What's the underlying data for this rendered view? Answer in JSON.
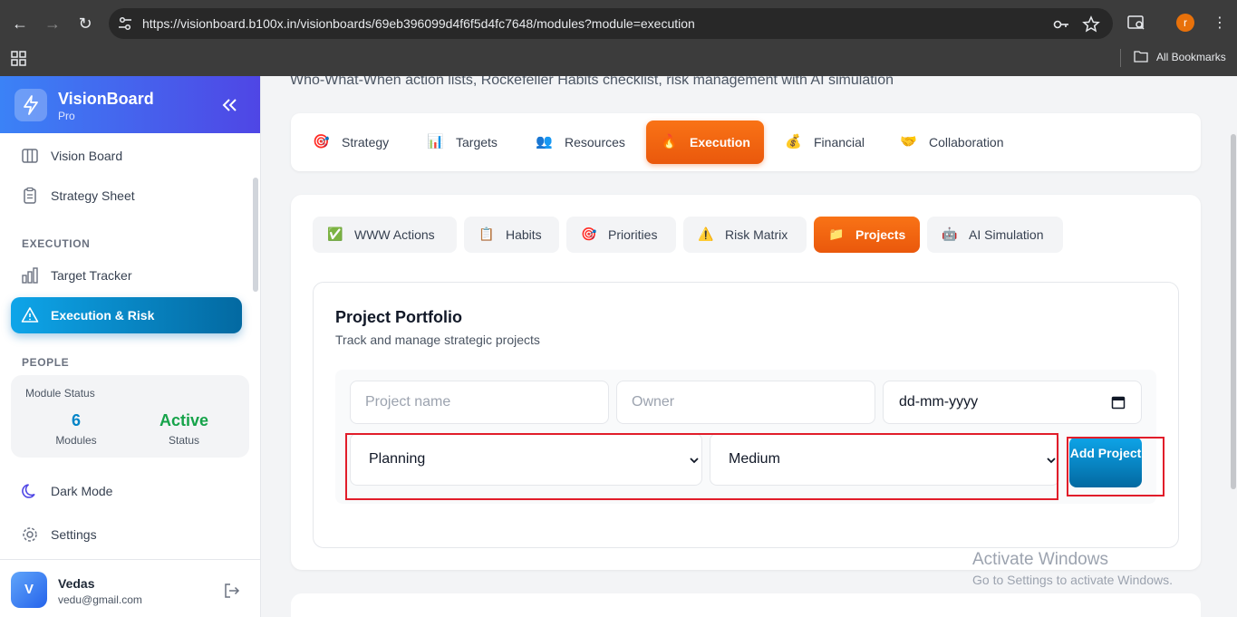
{
  "browser": {
    "url": "https://visionboard.b100x.in/visionboards/69eb396099d4f6f5d4fc7648/modules?module=execution",
    "profile_initial": "r",
    "bookmarks_label": "All Bookmarks"
  },
  "sidebar": {
    "brand_name": "VisionBoard",
    "brand_tier": "Pro",
    "items_top": [
      {
        "label": "Vision Board",
        "icon": "columns-icon"
      },
      {
        "label": "Strategy Sheet",
        "icon": "clipboard-icon"
      }
    ],
    "section_execution": "EXECUTION",
    "items_execution": [
      {
        "label": "Target Tracker",
        "icon": "bar-chart-icon"
      },
      {
        "label": "Execution & Risk",
        "icon": "warning-icon",
        "active": true
      }
    ],
    "section_people": "PEOPLE",
    "module_status": {
      "title": "Module Status",
      "modules_value": "6",
      "modules_label": "Modules",
      "status_value": "Active",
      "status_label": "Status"
    },
    "dark_mode": "Dark Mode",
    "settings": "Settings",
    "user": {
      "initial": "V",
      "name": "Vedas",
      "email": "vedu@gmail.com"
    }
  },
  "main": {
    "subtitle": "Who-What-When action lists, Rockefeller Habits checklist, risk management with AI simulation",
    "module_tabs": [
      {
        "label": "Strategy",
        "emoji": "🎯"
      },
      {
        "label": "Targets",
        "emoji": "📊"
      },
      {
        "label": "Resources",
        "emoji": "👥"
      },
      {
        "label": "Execution",
        "emoji": "🔥",
        "active": true
      },
      {
        "label": "Financial",
        "emoji": "💰"
      },
      {
        "label": "Collaboration",
        "emoji": "🤝"
      }
    ],
    "sub_tabs": [
      {
        "label": "WWW Actions",
        "emoji": "✅"
      },
      {
        "label": "Habits",
        "emoji": "📋"
      },
      {
        "label": "Priorities",
        "emoji": "🎯"
      },
      {
        "label": "Risk Matrix",
        "emoji": "⚠️"
      },
      {
        "label": "Projects",
        "emoji": "📁",
        "active": true
      },
      {
        "label": "AI Simulation",
        "emoji": "🤖"
      }
    ],
    "portfolio": {
      "title": "Project Portfolio",
      "subtitle": "Track and manage strategic projects",
      "project_name_placeholder": "Project name",
      "owner_placeholder": "Owner",
      "date_placeholder": "dd-mm-yyyy",
      "status_value": "Planning",
      "priority_value": "Medium",
      "add_button": "Add Project"
    }
  },
  "watermark": {
    "line1": "Activate Windows",
    "line2": "Go to Settings to activate Windows."
  },
  "colors": {
    "accent_orange": "#f97316",
    "accent_blue": "#0ea5e9",
    "brand_gradient_start": "#3b82f6",
    "brand_gradient_end": "#4f46e5",
    "active_green": "#16a34a",
    "modules_blue": "#0284c7",
    "highlight_red": "#e11d2a"
  }
}
